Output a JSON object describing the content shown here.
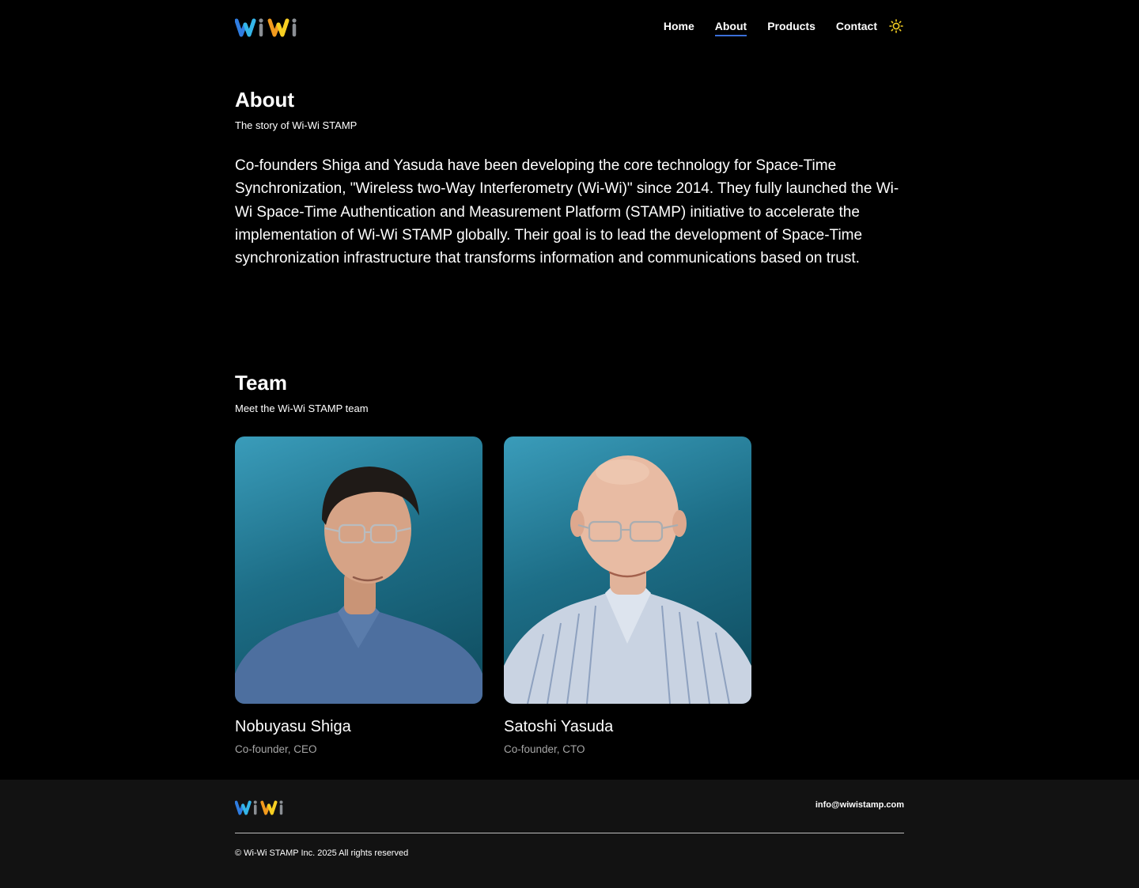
{
  "header": {
    "logo_text": "WiWi",
    "nav": [
      {
        "label": "Home",
        "active": false
      },
      {
        "label": "About",
        "active": true
      },
      {
        "label": "Products",
        "active": false
      },
      {
        "label": "Contact",
        "active": false
      }
    ],
    "theme_toggle_icon": "sun-icon"
  },
  "about": {
    "title": "About",
    "subtitle": "The story of Wi-Wi STAMP",
    "body": "Co-founders Shiga and Yasuda have been developing the core technology for Space-Time Synchronization, \"Wireless two-Way Interferometry (Wi-Wi)\" since 2014. They fully launched the Wi-Wi Space-Time Authentication and Measurement Platform (STAMP) initiative to accelerate the implementation of Wi-Wi STAMP globally. Their goal is to lead the development of Space-Time synchronization infrastructure that transforms information and communications based on trust."
  },
  "team": {
    "title": "Team",
    "subtitle": "Meet the Wi-Wi STAMP team",
    "members": [
      {
        "name": "Nobuyasu Shiga",
        "role": "Co-founder, CEO"
      },
      {
        "name": "Satoshi Yasuda",
        "role": "Co-founder, CTO"
      }
    ]
  },
  "footer": {
    "logo_text": "WiWi",
    "email": "info@wiwistamp.com",
    "copyright": "© Wi-Wi STAMP Inc. 2025 All rights reserved"
  },
  "colors": {
    "background": "#000000",
    "footer_background": "#121212",
    "active_underline": "#3b6fd8",
    "logo_blue": "#2f7de1",
    "logo_cyan": "#34b6e8",
    "logo_orange": "#f29a1d",
    "logo_yellow": "#f6cf22",
    "logo_gray": "#8b8f94"
  }
}
